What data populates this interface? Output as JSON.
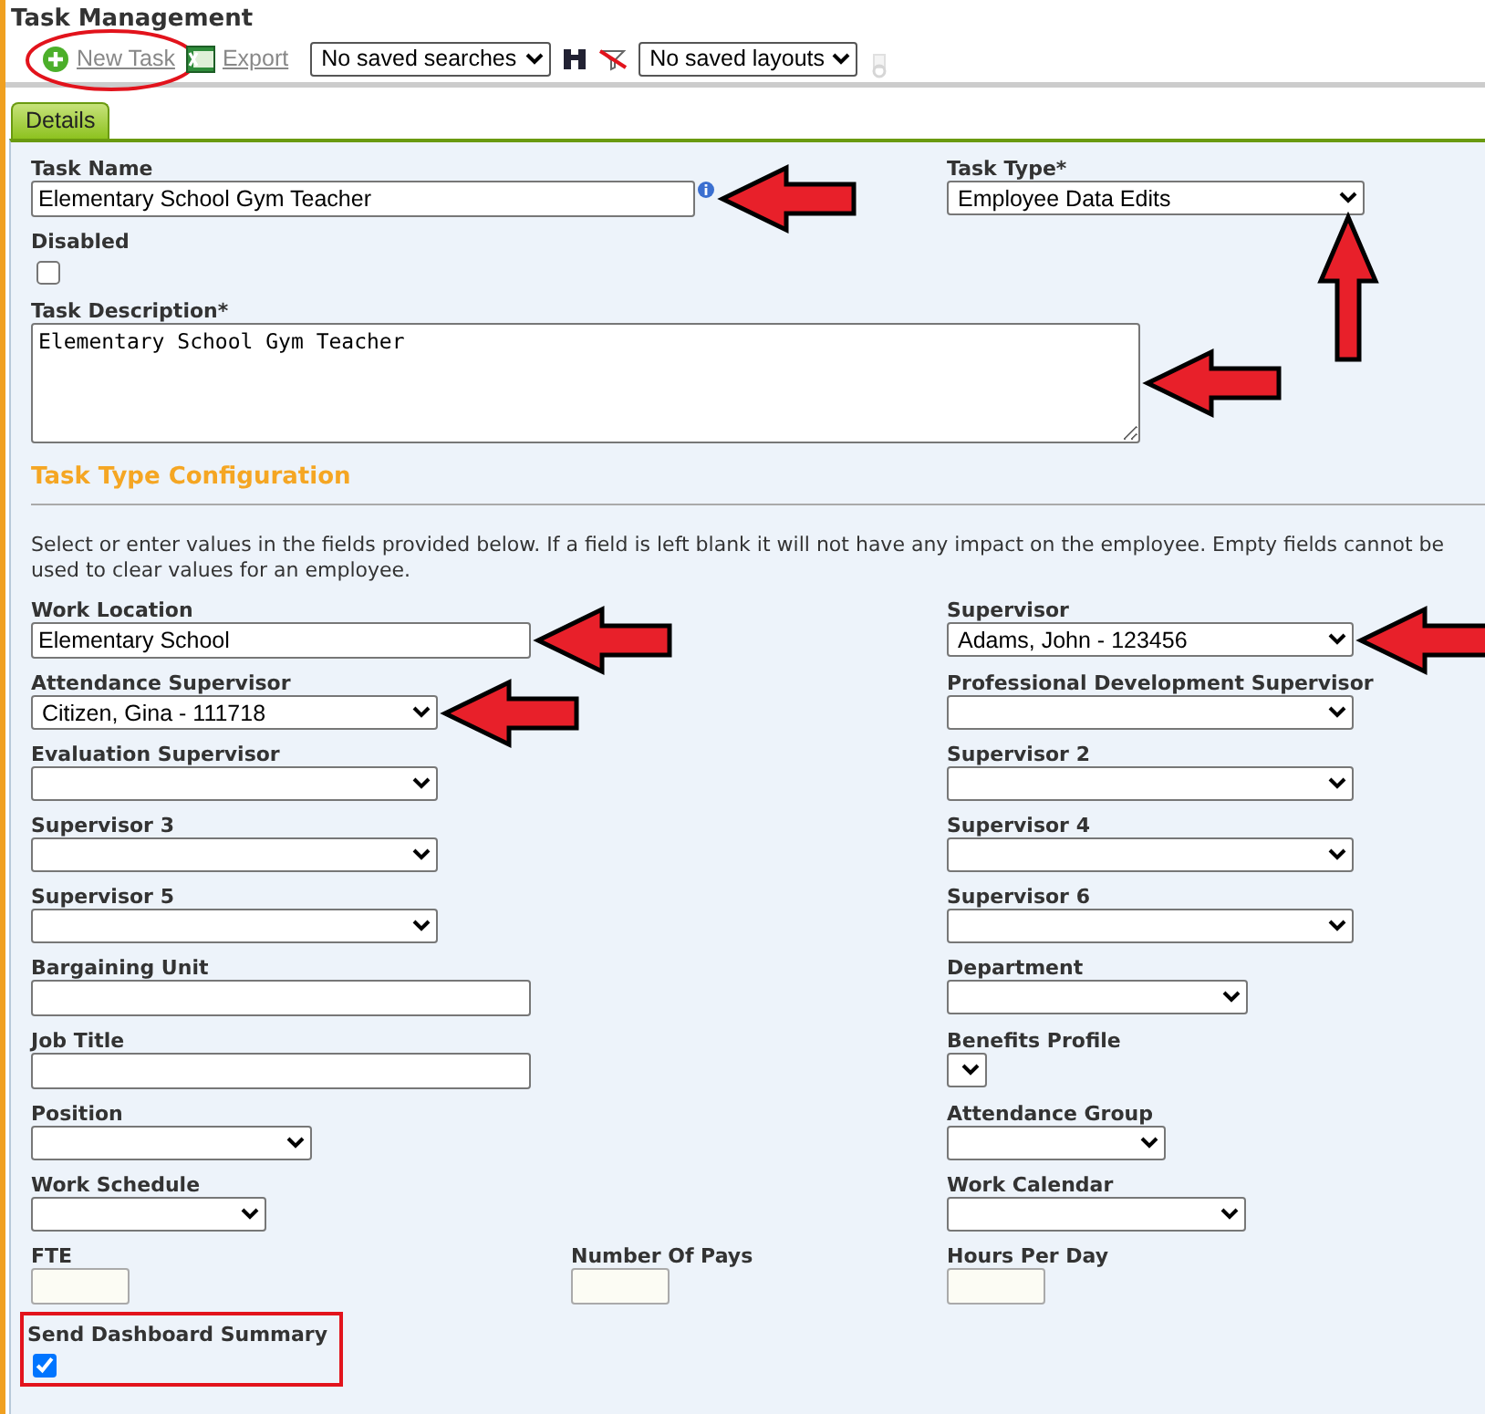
{
  "page": {
    "title": "Task Management"
  },
  "toolbar": [
    {
      "kind": "new-link",
      "label": "New Task",
      "circled": true
    },
    {
      "kind": "export-link",
      "label": "Export",
      "circled": false
    },
    {
      "kind": "select",
      "value": "No saved searches"
    },
    {
      "kind": "search-button"
    },
    {
      "kind": "clear-filter-button"
    },
    {
      "kind": "select",
      "value": "No saved layouts"
    },
    {
      "kind": "settings-button",
      "disabled": true
    }
  ],
  "tabs": [
    {
      "label": "Details",
      "selected": true
    }
  ],
  "top_rows": [
    {
      "left": {
        "label": "Task Name",
        "kind": "text",
        "value": "Elementary School Gym Teacher",
        "info": true,
        "arrow_left": true
      },
      "right": {
        "label": "Task Type*",
        "kind": "select",
        "value": "Employee Data Edits",
        "arrow_up": true
      }
    },
    {
      "left": {
        "label": "Disabled",
        "kind": "checkbox",
        "checked": false
      }
    },
    {
      "left": {
        "label": "Task Description*",
        "kind": "textarea",
        "value": "Elementary School Gym Teacher",
        "arrow_left": true
      }
    }
  ],
  "config": {
    "title": "Task Type Configuration",
    "note": "Select or enter values in the fields provided below. If a field is left blank it will not have any impact on the employee. Empty fields cannot be used to clear values for an employee.",
    "rows": [
      {
        "left": {
          "label": "Work Location",
          "kind": "text",
          "value": "Elementary School",
          "arrow_left": true
        },
        "right": {
          "label": "Supervisor",
          "kind": "select",
          "value": "Adams, John - 123456",
          "arrow_left": true
        }
      },
      {
        "left": {
          "label": "Attendance Supervisor",
          "kind": "select",
          "value": "Citizen, Gina - 111718",
          "arrow_left": true
        },
        "right": {
          "label": "Professional Development Supervisor",
          "kind": "select"
        }
      },
      {
        "left": {
          "label": "Evaluation Supervisor",
          "kind": "select"
        },
        "right": {
          "label": "Supervisor 2",
          "kind": "select"
        }
      },
      {
        "left": {
          "label": "Supervisor 3",
          "kind": "select"
        },
        "right": {
          "label": "Supervisor 4",
          "kind": "select"
        }
      },
      {
        "left": {
          "label": "Supervisor 5",
          "kind": "select"
        },
        "right": {
          "label": "Supervisor 6",
          "kind": "select"
        }
      },
      {
        "left": {
          "label": "Bargaining Unit",
          "kind": "text"
        },
        "right": {
          "label": "Department",
          "kind": "select"
        }
      },
      {
        "left": {
          "label": "Job Title",
          "kind": "text"
        },
        "right": {
          "label": "Benefits Profile",
          "kind": "select"
        }
      },
      {
        "left": {
          "label": "Position",
          "kind": "select"
        },
        "right": {
          "label": "Attendance Group",
          "kind": "select"
        }
      },
      {
        "left": {
          "label": "Work Schedule",
          "kind": "select"
        },
        "right": {
          "label": "Work Calendar",
          "kind": "select"
        }
      },
      {
        "left": {
          "label": "FTE",
          "kind": "text"
        },
        "middle": {
          "label": "Number Of Pays",
          "kind": "text"
        },
        "right": {
          "label": "Hours Per Day",
          "kind": "text"
        }
      },
      {
        "left": {
          "label": "Send Dashboard Summary",
          "kind": "checkbox",
          "checked": true,
          "boxed": true
        }
      }
    ]
  }
}
